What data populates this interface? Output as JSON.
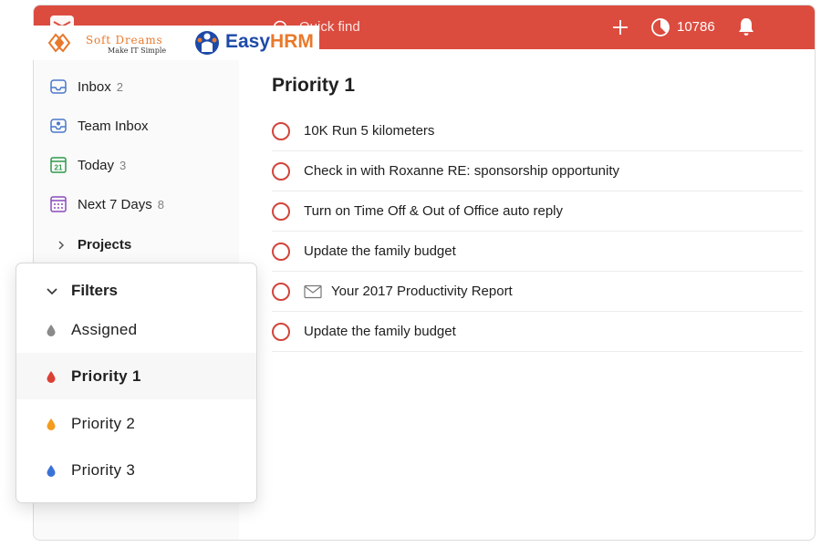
{
  "topbar": {
    "search_label": "Quick find",
    "karma_count": "10786",
    "icons": [
      "app-logo-icon",
      "search-icon",
      "add-icon",
      "karma-icon",
      "bell-icon"
    ]
  },
  "brand": {
    "softdreams_name": "Soft Dreams",
    "softdreams_tagline": "Make IT Simple",
    "easyhrm_easy": "Easy",
    "easyhrm_hrm": "HRM"
  },
  "sidebar": {
    "items": [
      {
        "label": "Inbox",
        "count": "2",
        "icon": "inbox-icon"
      },
      {
        "label": "Team Inbox",
        "count": "",
        "icon": "team-inbox-icon"
      },
      {
        "label": "Today",
        "count": "3",
        "icon": "calendar-today-icon"
      },
      {
        "label": "Next 7 Days",
        "count": "8",
        "icon": "calendar-week-icon"
      }
    ],
    "projects_label": "Projects"
  },
  "filters": {
    "title": "Filters",
    "items": [
      {
        "label": "Assigned",
        "color": "#8a8a8a",
        "selected": false
      },
      {
        "label": "Priority 1",
        "color": "#db4035",
        "selected": true
      },
      {
        "label": "Priority 2",
        "color": "#f39c1f",
        "selected": false
      },
      {
        "label": "Priority 3",
        "color": "#3a73d6",
        "selected": false
      }
    ]
  },
  "main": {
    "title": "Priority 1",
    "tasks": [
      {
        "text": "10K Run 5 kilometers"
      },
      {
        "text": "Check in with Roxanne RE: sponsorship opportunity"
      },
      {
        "text": "Turn on Time Off & Out of Office auto reply"
      },
      {
        "text": "Update the family budget"
      },
      {
        "text": "Your 2017 Productivity Report",
        "icon": "mail-icon"
      },
      {
        "text": "Update the family budget"
      }
    ]
  },
  "colors": {
    "accent": "#db4c3f",
    "priority_1": "#db4035",
    "priority_2": "#f39c1f",
    "priority_3": "#3a73d6"
  }
}
